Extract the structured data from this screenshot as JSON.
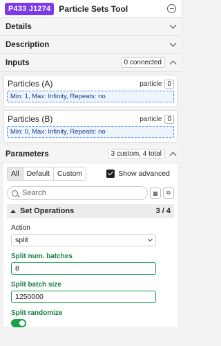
{
  "header": {
    "badge": "P433 J1274",
    "title": "Particle Sets Tool"
  },
  "sections": {
    "details": "Details",
    "description": "Description",
    "inputs": {
      "label": "Inputs",
      "status": "0 connected"
    },
    "parameters": {
      "label": "Parameters",
      "status": "3 custom, 4 total"
    }
  },
  "inputs": [
    {
      "name": "Particles (A)",
      "type": "particle",
      "count": "0",
      "constraint": "Min: 1, Max: Infinity, Repeats: no"
    },
    {
      "name": "Particles (B)",
      "type": "particle",
      "count": "0",
      "constraint": "Min: 0, Max: Infinity, Repeats: no"
    }
  ],
  "params": {
    "tabs": [
      "All",
      "Default",
      "Custom"
    ],
    "show_advanced_label": "Show advanced",
    "search_placeholder": "Search",
    "group": {
      "title": "Set Operations",
      "count": "3 / 4"
    },
    "action": {
      "label": "Action",
      "value": "split"
    },
    "num_batches": {
      "label": "Split num. batches",
      "value": "8"
    },
    "batch_size": {
      "label": "Split batch size",
      "value": "1250000"
    },
    "randomize": {
      "label": "Split randomize",
      "value": true
    }
  },
  "colors": {
    "badge": "#7c3aed",
    "custom_param": "#16a34a",
    "constraint_border": "#3b82f6"
  }
}
